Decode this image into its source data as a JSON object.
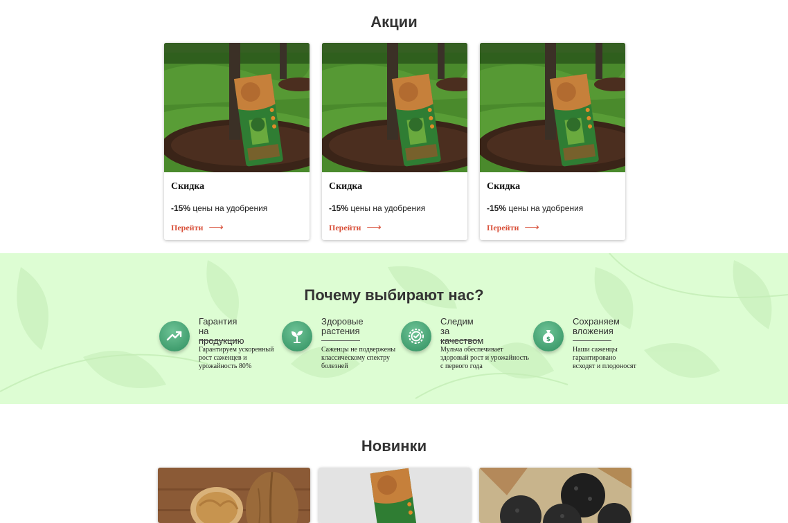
{
  "promotions": {
    "title": "Акции",
    "cards": [
      {
        "title": "Скидка",
        "discount": "-15%",
        "text": " цены на удобрения",
        "link": "Перейти",
        "image": "mulch-bag-under-tree"
      },
      {
        "title": "Скидка",
        "discount": "-15%",
        "text": " цены на удобрения",
        "link": "Перейти",
        "image": "mulch-bag-under-tree"
      },
      {
        "title": "Скидка",
        "discount": "-15%",
        "text": " цены на удобрения",
        "link": "Перейти",
        "image": "mulch-bag-under-tree"
      }
    ]
  },
  "why_us": {
    "title": "Почему выбирают нас?",
    "features": [
      {
        "icon": "trending-up-icon",
        "title": "Гарантия\nна продукцию",
        "desc": "Гарантируем ускоренный\nрост саженцев и\nурожайность 80%"
      },
      {
        "icon": "sprout-icon",
        "title": "Здоровые\nрастения",
        "desc": "Саженцы не подвержены\nклассическому спектру\nболезней"
      },
      {
        "icon": "quality-badge-icon",
        "title": "Следим\nза качеством",
        "desc": "Мульча обеспечивает\nздоровый рост и урожайность\nс первого года"
      },
      {
        "icon": "money-bag-icon",
        "title": "Сохраняем\nвложения",
        "desc": "Наши саженцы\nгарантировано\nвсходят и плодоносят"
      }
    ]
  },
  "new_items": {
    "title": "Новинки",
    "cards": [
      {
        "image": "walnuts"
      },
      {
        "image": "mulch-bag"
      },
      {
        "image": "black-truffles"
      }
    ]
  },
  "colors": {
    "accent": "#d9533d",
    "why_bg": "#ddfdd3",
    "icon_green": "#3c9c6b"
  }
}
